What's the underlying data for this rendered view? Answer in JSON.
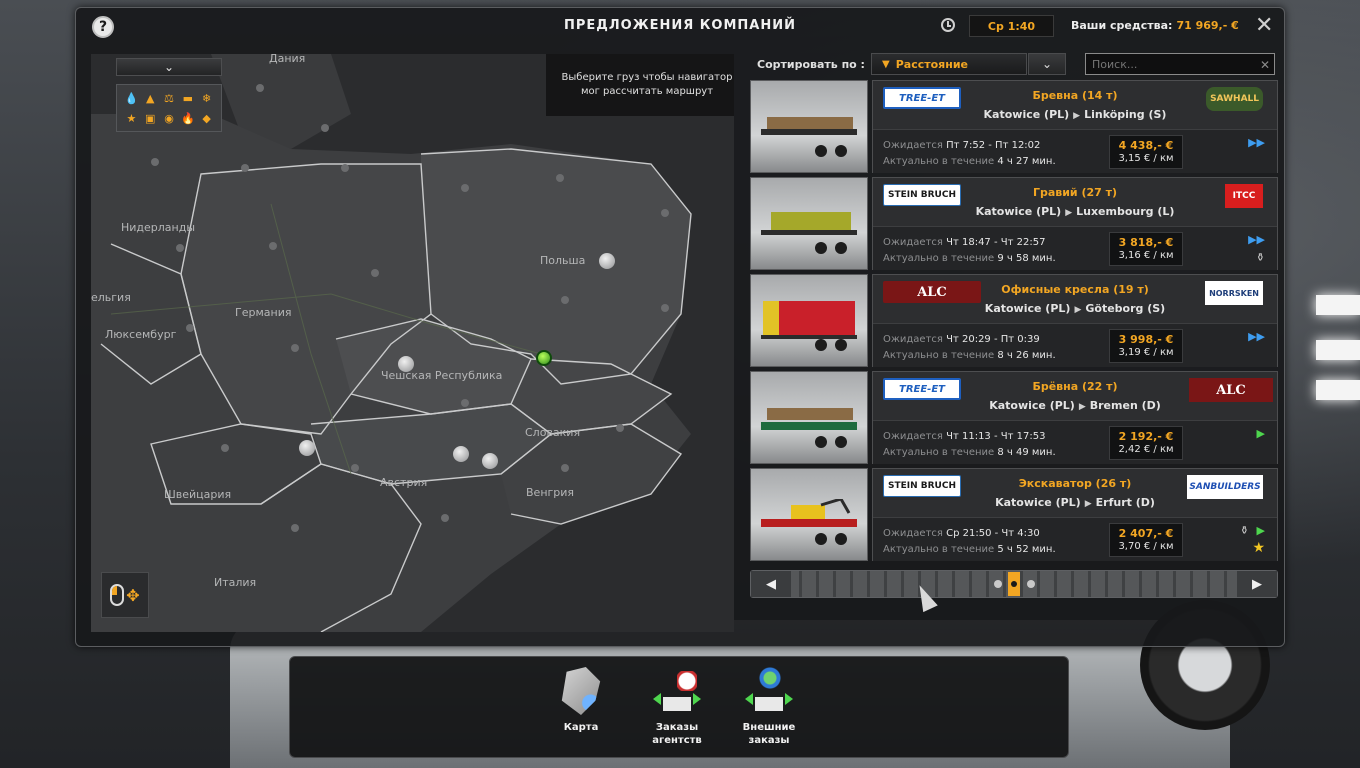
{
  "header": {
    "help": "?",
    "title": "ПРЕДЛОЖЕНИЯ КОМПАНИЙ",
    "time": "Ср 1:40",
    "funds_label": "Ваши средства:",
    "funds_value": "71 969,- €",
    "close": "✕"
  },
  "map": {
    "dropdown": "⌄",
    "hint": "Выберите груз чтобы навигатор мог рассчитать маршрут",
    "labels": {
      "denmark": "Дания",
      "netherlands": "Нидерланды",
      "belgium": "ельгия",
      "luxembourg": "Люксембург",
      "germany": "Германия",
      "poland": "Польша",
      "czech": "Чешская Республика",
      "slovakia": "Словакия",
      "austria": "Австрия",
      "hungary": "Венгрия",
      "switzerland": "Швейцария",
      "italy": "Италия"
    }
  },
  "sort": {
    "label": "Сортировать по :",
    "value": "Расстояние",
    "search_placeholder": "Поиск...",
    "clear": "✕"
  },
  "jobs": [
    {
      "company": "TREE-ET",
      "dest_company": "SAWHALL",
      "cargo": "Бревна (14 т)",
      "from": "Katowice (PL)",
      "to": "Linköping (S)",
      "expected_label": "Ожидается",
      "expected": "Пт 7:52 - Пт 12:02",
      "valid_label": "Актуально в течение",
      "valid": "4 ч 27 мин.",
      "price": "4 438,- €",
      "per_km": "3,15 € / км"
    },
    {
      "company": "STEIN BRUCH",
      "dest_company": "ITCC",
      "cargo": "Гравий (27 т)",
      "from": "Katowice (PL)",
      "to": "Luxembourg (L)",
      "expected_label": "Ожидается",
      "expected": "Чт 18:47 - Чт 22:57",
      "valid_label": "Актуально в течение",
      "valid": "9 ч 58 мин.",
      "price": "3 818,- €",
      "per_km": "3,16 € / км"
    },
    {
      "company": "ALC",
      "dest_company": "NORRSKEN",
      "cargo": "Офисные кресла (19 т)",
      "from": "Katowice (PL)",
      "to": "Göteborg (S)",
      "expected_label": "Ожидается",
      "expected": "Чт 20:29 - Пт 0:39",
      "valid_label": "Актуально в течение",
      "valid": "8 ч 26 мин.",
      "price": "3 998,- €",
      "per_km": "3,19 € / км"
    },
    {
      "company": "TREE-ET",
      "dest_company": "ALC",
      "cargo": "Брёвна (22 т)",
      "from": "Katowice (PL)",
      "to": "Bremen (D)",
      "expected_label": "Ожидается",
      "expected": "Чт 11:13 - Чт 17:53",
      "valid_label": "Актуально в течение",
      "valid": "8 ч 49 мин.",
      "price": "2 192,- €",
      "per_km": "2,42 € / км"
    },
    {
      "company": "STEIN BRUCH",
      "dest_company": "SANBUILDERS",
      "cargo": "Экскаватор (26 т)",
      "from": "Katowice (PL)",
      "to": "Erfurt (D)",
      "expected_label": "Ожидается",
      "expected": "Ср 21:50 - Чт 4:30",
      "valid_label": "Актуально в течение",
      "valid": "5 ч 52 мин.",
      "price": "2 407,- €",
      "per_km": "3,70 € / км"
    }
  ],
  "nav": {
    "map": "Карта",
    "agency": "Заказы агентств",
    "external": "Внешние заказы"
  },
  "colors": {
    "accent": "#f2a623",
    "panel": "#2d2e30",
    "ff_blue": "#3e9df0",
    "play_green": "#4ed64e"
  }
}
